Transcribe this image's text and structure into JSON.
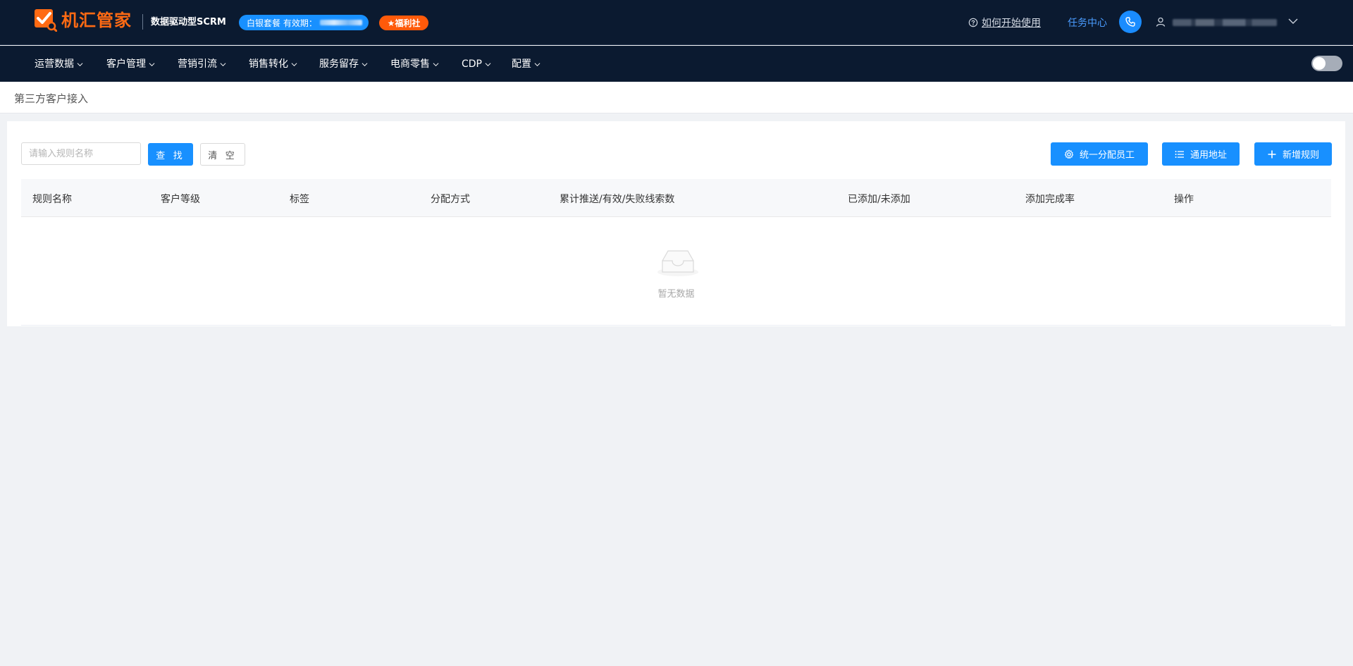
{
  "header": {
    "logo_text": "机汇管家",
    "slogan": "数据驱动型SCRM",
    "package_label": "白银套餐 有效期：",
    "welfare_label": "★福利社",
    "help_label": "如何开始使用",
    "task_center_label": "任务中心"
  },
  "nav": {
    "items": [
      {
        "label": "运营数据"
      },
      {
        "label": "客户管理"
      },
      {
        "label": "营销引流"
      },
      {
        "label": "销售转化"
      },
      {
        "label": "服务留存"
      },
      {
        "label": "电商零售"
      },
      {
        "label": "CDP"
      },
      {
        "label": "配置"
      }
    ]
  },
  "page": {
    "title": "第三方客户接入"
  },
  "toolbar": {
    "search_placeholder": "请输入规则名称",
    "search_label": "查 找",
    "clear_label": "清 空",
    "assign_label": "统一分配员工",
    "address_label": "通用地址",
    "new_rule_label": "新增规则"
  },
  "table": {
    "columns": [
      "规则名称",
      "客户等级",
      "标签",
      "分配方式",
      "累计推送/有效/失败线索数",
      "已添加/未添加",
      "添加完成率",
      "操作"
    ],
    "empty_text": "暂无数据"
  },
  "colors": {
    "header_bg": "#0b1a30",
    "primary": "#1890ff",
    "brand_orange": "#ff6a13"
  }
}
